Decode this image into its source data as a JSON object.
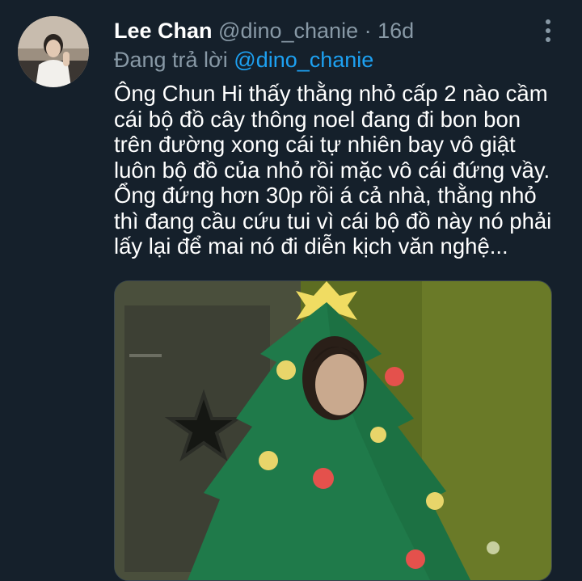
{
  "tweet": {
    "author_name": "Lee Chan",
    "author_handle": "@dino_chanie",
    "separator": "·",
    "timestamp": "16d",
    "reply_prefix": "Đang trả lời",
    "reply_to": "@dino_chanie",
    "text_lines": [
      "Ông Chun Hi thấy thằng nhỏ cấp 2 nào cầm",
      "cái bộ đồ cây thông noel đang đi bon bon",
      "trên đường xong cái tự nhiên bay vô giật",
      "luôn bộ đồ của nhỏ rồi mặc vô cái đứng vầy.",
      "Ổng đứng hơn 30p rồi á cả nhà, thằng nhỏ",
      "thì đang cầu cứu tui vì cái bộ đồ này nó phải",
      "lấy lại để mai nó đi diễn kịch văn nghệ..."
    ],
    "media": {
      "description_icon": "photo",
      "tree_color": "#1f7a4a",
      "background_color": "#5a6b20"
    }
  },
  "icons": {
    "more": "more-vertical-icon"
  },
  "colors": {
    "background": "#15202b",
    "secondary_text": "#8899a6",
    "link": "#1da1f2"
  }
}
